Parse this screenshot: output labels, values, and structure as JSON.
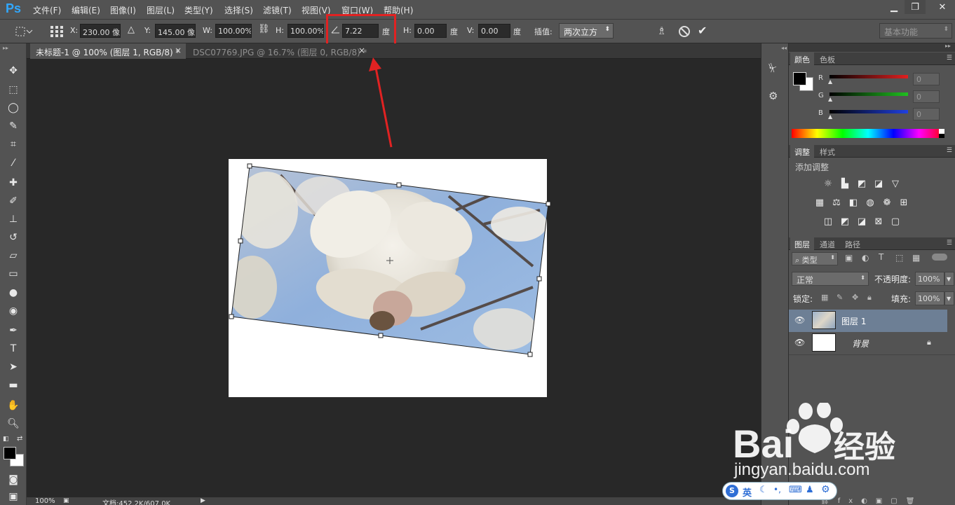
{
  "app": {
    "logo": "Ps"
  },
  "menu": [
    "文件(F)",
    "编辑(E)",
    "图像(I)",
    "图层(L)",
    "类型(Y)",
    "选择(S)",
    "滤镜(T)",
    "视图(V)",
    "窗口(W)",
    "帮助(H)"
  ],
  "window_controls": {
    "minimize": "▁",
    "restore": "❐",
    "close": "✕"
  },
  "options": {
    "x_label": "X:",
    "x_value": "230.00 像",
    "y_label": "Y:",
    "y_value": "145.00 像",
    "w_label": "W:",
    "w_value": "100.00%",
    "h_label": "H:",
    "h_value": "100.00%",
    "angle_value": "7.22",
    "angle_unit": "度",
    "hskew_label": "H:",
    "hskew_value": "0.00",
    "hskew_unit": "度",
    "vskew_label": "V:",
    "vskew_value": "0.00",
    "vskew_unit": "度",
    "interp_label": "插值:",
    "interp_value": "两次立方",
    "workspace": "基本功能"
  },
  "tabs": [
    {
      "label": "未标题-1 @ 100% (图层 1, RGB/8) *",
      "active": true
    },
    {
      "label": "DSC07769.JPG @ 16.7% (图层 0, RGB/8) *",
      "active": false
    }
  ],
  "tab_close": "×",
  "status": {
    "zoom": "100%",
    "doc": "文档:452.2K/607.0K"
  },
  "color_panel": {
    "tabs": [
      "颜色",
      "色板"
    ],
    "channels": [
      {
        "name": "R",
        "value": "0",
        "color": "#e02020"
      },
      {
        "name": "G",
        "value": "0",
        "color": "#20c020"
      },
      {
        "name": "B",
        "value": "0",
        "color": "#2040e0"
      }
    ]
  },
  "adjust_panel": {
    "tabs": [
      "调整",
      "样式"
    ],
    "title": "添加调整"
  },
  "layers_panel": {
    "tabs": [
      "图层",
      "通道",
      "路径"
    ],
    "filter_kind": "类型",
    "blend_mode": "正常",
    "opacity_label": "不透明度:",
    "opacity_value": "100%",
    "lock_label": "锁定:",
    "fill_label": "填充:",
    "fill_value": "100%",
    "layers": [
      {
        "name": "图层 1",
        "selected": true
      },
      {
        "name": "背景",
        "selected": false
      }
    ]
  },
  "watermark": {
    "domain": "jingyan.baidu.com"
  },
  "ime_toolbar": {
    "lang": "英"
  }
}
